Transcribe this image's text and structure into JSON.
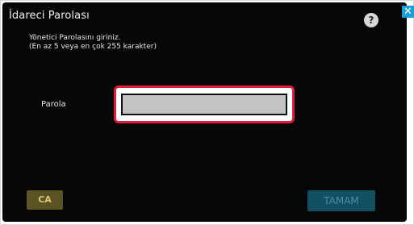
{
  "dialog": {
    "title": "İdareci Parolası",
    "help_icon_glyph": "?",
    "close_icon_glyph": "✕",
    "instruction_line1": "Yönetici Parolasını giriniz.",
    "instruction_line2": "(En az 5 veya en çok 255 karakter)"
  },
  "form": {
    "password_label": "Parola",
    "password_value": "",
    "password_placeholder": ""
  },
  "buttons": {
    "clear_label": "CA",
    "ok_label": "TAMAM"
  },
  "icons": {
    "help": "help-icon",
    "close": "close-icon"
  },
  "colors": {
    "dialog_background": "#070707",
    "highlight_border": "#e01e3c",
    "close_button": "#1aa0d8",
    "ok_button": "#114f63",
    "clear_button": "#5c5324"
  }
}
